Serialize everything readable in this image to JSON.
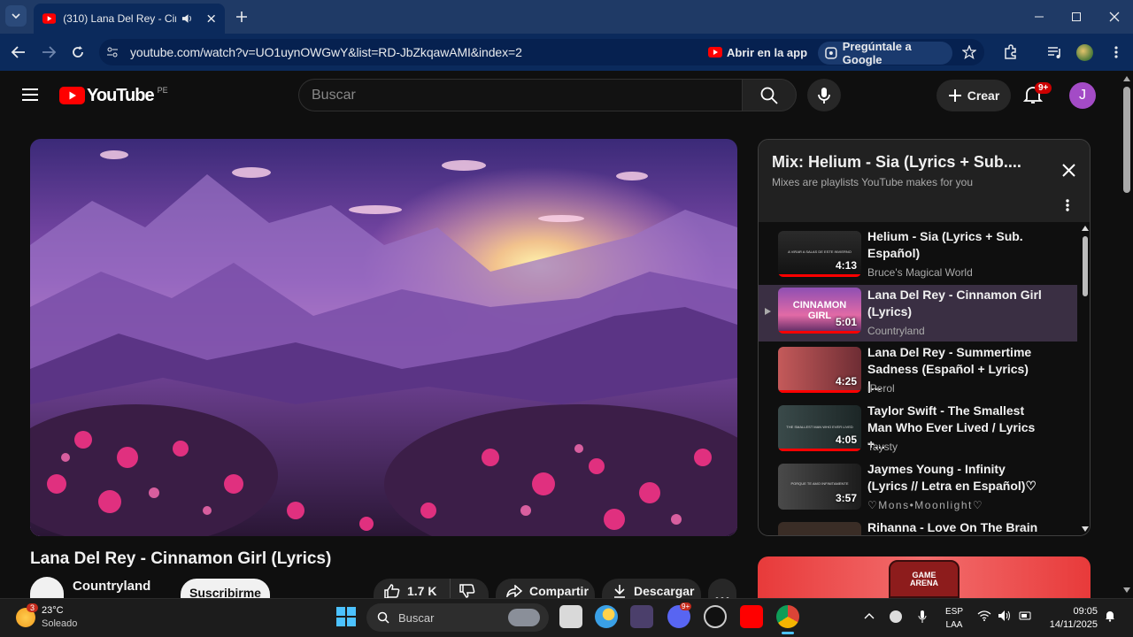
{
  "browser": {
    "tab_title": "(310) Lana Del Rey - Cinnam",
    "url": "youtube.com/watch?v=UO1uynOWGwY&list=RD-JbZkqawAMI&index=2",
    "open_app_label": "Abrir en la app",
    "ask_google_label": "Pregúntale a Google"
  },
  "youtube": {
    "logo_text": "YouTube",
    "country": "PE",
    "search_placeholder": "Buscar",
    "create_label": "Crear",
    "notif_count": "9+",
    "avatar_letter": "J"
  },
  "video": {
    "title": "Lana Del Rey - Cinnamon Girl (Lyrics)",
    "channel": "Countryland",
    "subscribe_label": "Suscribirme",
    "likes": "1.7 K",
    "share_label": "Compartir",
    "download_label": "Descargar"
  },
  "mix": {
    "title": "Mix: Helium - Sia (Lyrics + Sub....",
    "subtitle": "Mixes are playlists YouTube makes for you",
    "items": [
      {
        "title": "Helium - Sia (Lyrics + Sub. Español)",
        "channel": "Bruce's Magical World",
        "duration": "4:13",
        "overlay": "A VIRAR A SALAS DE ESTE INVIERNO"
      },
      {
        "title": "Lana Del Rey - Cinnamon Girl (Lyrics)",
        "channel": "Countryland",
        "duration": "5:01",
        "overlay": "CINNAMON GIRL"
      },
      {
        "title": "Lana Del Rey - Summertime Sadness (Español + Lyrics) |...",
        "channel": "iPerol",
        "duration": "4:25",
        "overlay": ""
      },
      {
        "title": "Taylor Swift - The Smallest Man Who Ever Lived / Lyrics +...",
        "channel": "Taysty",
        "duration": "4:05",
        "overlay": "THE SMALLEST MAN WHO EVER LIVED"
      },
      {
        "title": "Jaymes Young - Infinity (Lyrics // Letra en Español)♡",
        "channel": "♡Mons•Moonlight♡",
        "duration": "3:57",
        "overlay": "PORQUE TE AMO INFINITAMENTE"
      },
      {
        "title": "Rihanna - Love On The Brain",
        "channel": "",
        "duration": "",
        "overlay": ""
      }
    ]
  },
  "ad": {
    "text": "GAME ARENA"
  },
  "taskbar": {
    "temp": "23°C",
    "weather": "Soleado",
    "weather_badge": "3",
    "search_label": "Buscar",
    "lang_top": "ESP",
    "lang_bottom": "LAA",
    "time": "09:05",
    "date": "14/11/2025",
    "discord_badge": "9+"
  }
}
